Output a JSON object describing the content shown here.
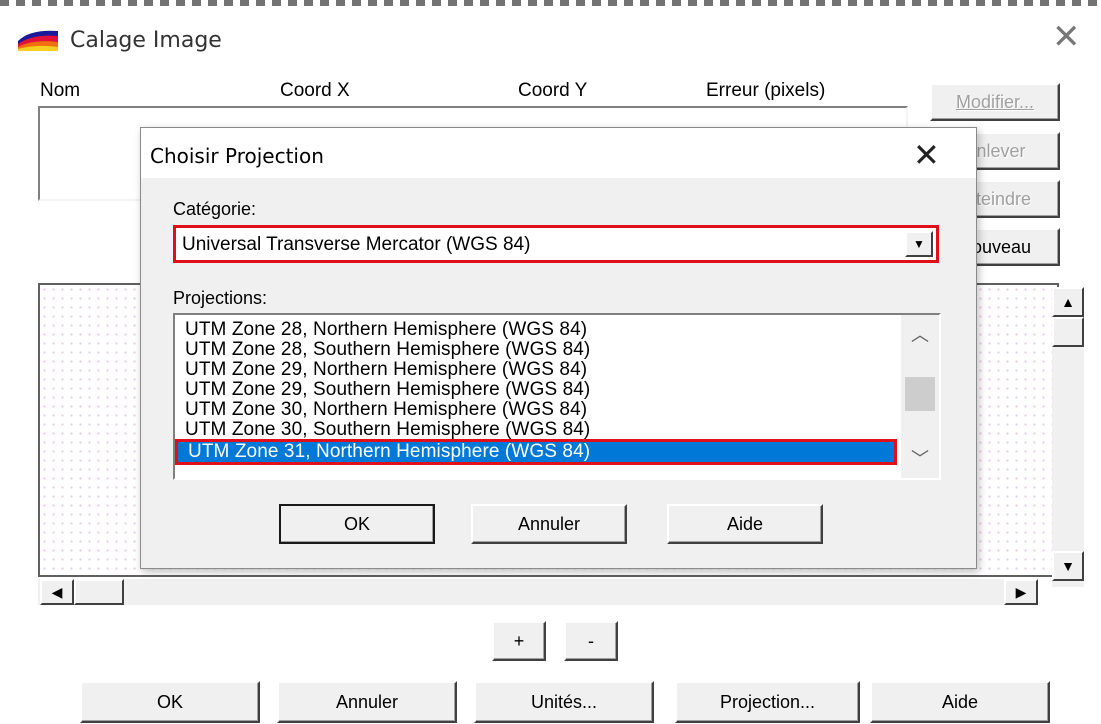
{
  "window": {
    "title": "Calage Image",
    "close_glyph": "✕"
  },
  "columns": [
    "Nom",
    "Coord X",
    "Coord Y",
    "Erreur (pixels)"
  ],
  "side_buttons": {
    "modifier": "Modifier...",
    "enlever": "Enlever",
    "atteindre": "Atteindre",
    "nouveau": "Nouveau"
  },
  "zoom": {
    "plus": "+",
    "minus": "-"
  },
  "bottom_buttons": {
    "ok": "OK",
    "cancel": "Annuler",
    "units": "Unités...",
    "projection": "Projection...",
    "help": "Aide"
  },
  "dialog": {
    "title": "Choisir Projection",
    "close_glyph": "✕",
    "category_label": "Catégorie:",
    "category_value": "Universal Transverse Mercator (WGS 84)",
    "projections_label": "Projections:",
    "projections": [
      "UTM Zone 28, Northern Hemisphere (WGS 84)",
      "UTM Zone 28, Southern Hemisphere (WGS 84)",
      "UTM Zone 29, Northern Hemisphere (WGS 84)",
      "UTM Zone 29, Southern Hemisphere (WGS 84)",
      "UTM Zone 30, Northern Hemisphere (WGS 84)",
      "UTM Zone 30, Southern Hemisphere (WGS 84)",
      "UTM Zone 31, Northern Hemisphere (WGS 84)"
    ],
    "selected_index": 6,
    "ok": "OK",
    "cancel": "Annuler",
    "help": "Aide"
  },
  "colors": {
    "selection": "#0078d7",
    "highlight_border": "#e0101b"
  }
}
